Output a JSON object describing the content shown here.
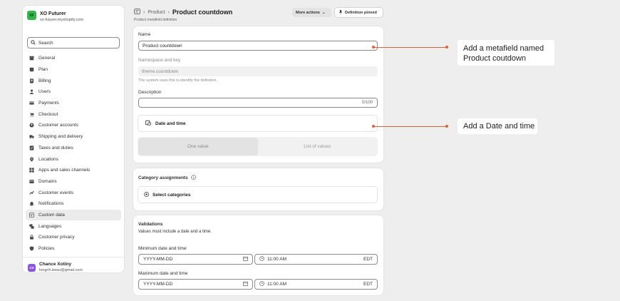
{
  "store": {
    "logo_text": "XF",
    "name": "XO Futurer",
    "domain": "xo-futurer.myshopify.com"
  },
  "search": {
    "placeholder": "Search"
  },
  "nav": [
    {
      "label": "General",
      "icon": "store-icon"
    },
    {
      "label": "Plan",
      "icon": "plan-icon"
    },
    {
      "label": "Billing",
      "icon": "billing-icon"
    },
    {
      "label": "Users",
      "icon": "user-icon"
    },
    {
      "label": "Payments",
      "icon": "payments-icon"
    },
    {
      "label": "Checkout",
      "icon": "cart-icon"
    },
    {
      "label": "Customer accounts",
      "icon": "customer-accounts-icon"
    },
    {
      "label": "Shipping and delivery",
      "icon": "truck-icon"
    },
    {
      "label": "Taxes and duties",
      "icon": "taxes-icon"
    },
    {
      "label": "Locations",
      "icon": "location-icon"
    },
    {
      "label": "Apps and sales channels",
      "icon": "apps-icon"
    },
    {
      "label": "Domains",
      "icon": "globe-icon"
    },
    {
      "label": "Customer events",
      "icon": "events-icon"
    },
    {
      "label": "Notifications",
      "icon": "bell-icon"
    },
    {
      "label": "Custom data",
      "icon": "custom-data-icon",
      "active": true
    },
    {
      "label": "Languages",
      "icon": "language-icon"
    },
    {
      "label": "Customer privacy",
      "icon": "lock-icon"
    },
    {
      "label": "Policies",
      "icon": "policies-icon"
    }
  ],
  "user": {
    "initials": "CX",
    "name": "Chance Xotiny",
    "email": "longnh.beau@gmail.com"
  },
  "header": {
    "crumb_parent": "Product",
    "title": "Product countdown",
    "subtitle": "Product metafield definition",
    "more_actions": "More actions",
    "pinned": "Definition pinned"
  },
  "definition": {
    "name_label": "Name",
    "name_value": "Product countdown",
    "ns_label": "Namespace and key",
    "ns_value": "theme.countdown",
    "ns_help": "The system uses this to identify the definition.",
    "desc_label": "Description",
    "desc_counter": "0/100",
    "type_label": "Date and time",
    "seg_one": "One value",
    "seg_list": "List of values"
  },
  "category": {
    "title": "Category assignments",
    "select": "Select categories"
  },
  "validations": {
    "title": "Validations",
    "help": "Values must include a date and a time.",
    "min_label": "Minimum date and time",
    "max_label": "Maximum date and time",
    "date_placeholder": "YYYY-MM-DD",
    "time_value": "11:00 AM",
    "tz": "EDT"
  },
  "annotations": {
    "first": "Add a metafield named Product coutdown",
    "second": "Add a Date and time"
  },
  "colors": {
    "accent": "#d9623b",
    "store_logo": "#36b34a",
    "avatar": "#8c54d6"
  }
}
